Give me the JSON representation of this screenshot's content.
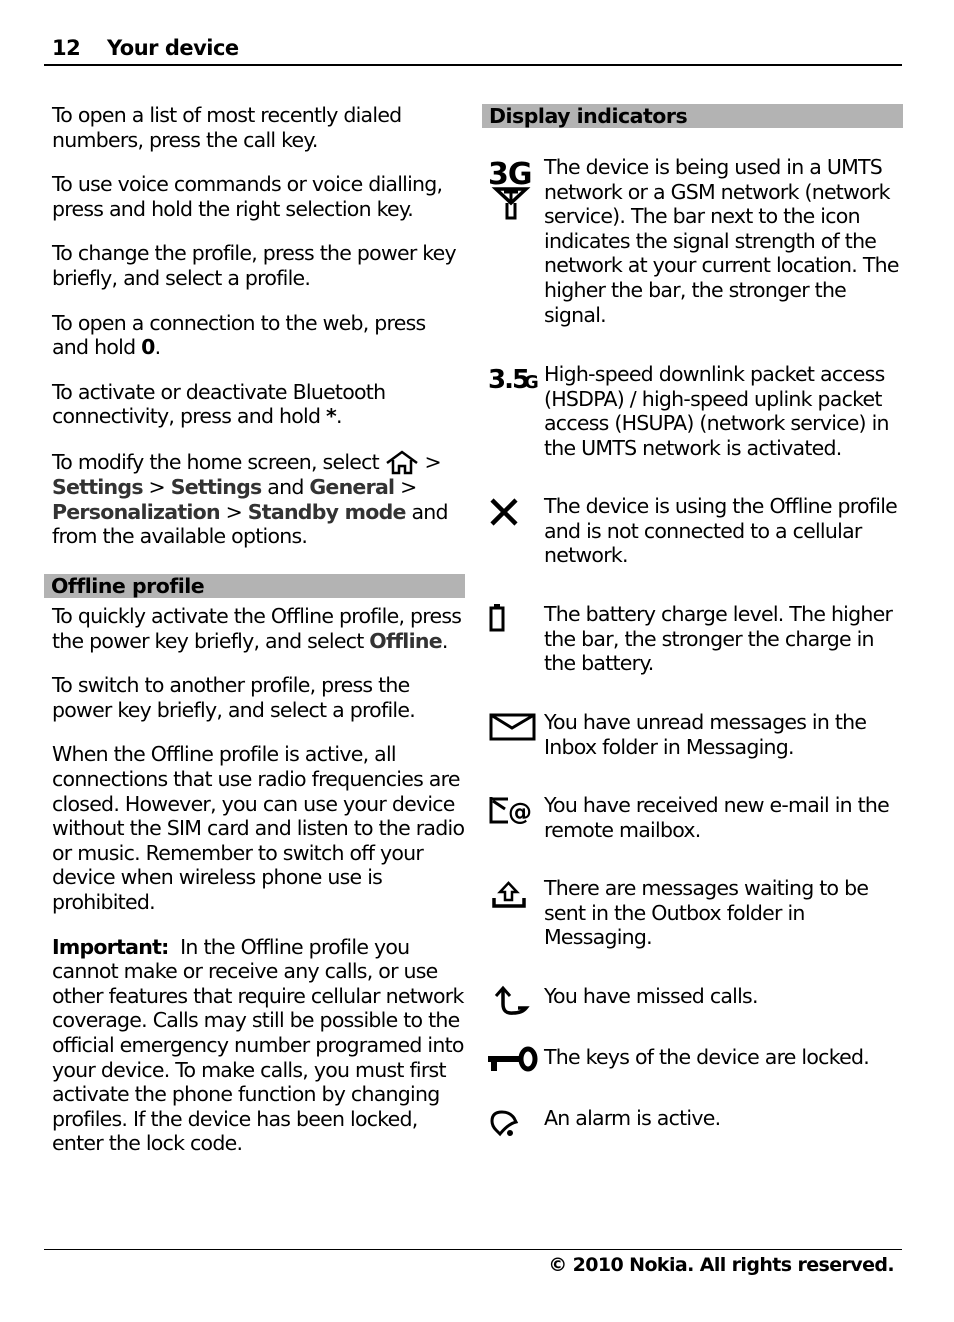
{
  "header": {
    "page_number": "12",
    "title": "Your device"
  },
  "left": {
    "p1": "To open a list of most recently dialed numbers, press the call key.",
    "p2": "To use voice commands or voice dialling, press and hold the right selection key.",
    "p3": "To change the profile, press the power key briefly, and select a profile.",
    "p4_pre": "To open a connection to the web, press and hold ",
    "p4_key": "0",
    "p4_post": ".",
    "p5_pre": "To activate or deactivate Bluetooth connectivity, press and hold ",
    "p5_key": "*",
    "p5_post": ".",
    "p6": {
      "pre": "To modify the home screen, select ",
      "icon": "home-icon",
      "sep1": " > ",
      "settings1": "Settings",
      "sep2": " > ",
      "settings2": "Settings",
      "and": " and ",
      "general": "General",
      "sep3": " > ",
      "personalization": "Personalization",
      "sep4": " > ",
      "standby": "Standby mode",
      "post": " and from the available options."
    },
    "offline_heading": "Offline profile",
    "op1_pre": "To quickly activate the Offline profile, press the power key briefly, and select ",
    "op1_ui": "Offline",
    "op1_post": ".",
    "op2": "To switch to another profile, press the power key briefly, and select a profile.",
    "op3": "When the Offline profile is active, all connections that use radio frequencies are closed. However, you can use your device without the SIM card and listen to the radio or music. Remember to switch off your device when wireless phone use is prohibited.",
    "important_label": "Important:",
    "important_text": "In the Offline profile you cannot make or receive any calls, or use other features that require cellular network coverage. Calls may still be possible to the official emergency number programed into your device. To make calls, you must first activate the phone function by changing profiles. If the device has been locked, enter the lock code."
  },
  "right": {
    "heading": "Display indicators",
    "indicators": [
      {
        "icon": "3g-signal-icon",
        "icon_text": "3G",
        "text": "The device is being used in a UMTS network or a GSM network (network service). The bar next to the icon indicates the signal strength of the network at your current location. The higher the bar, the stronger the signal."
      },
      {
        "icon": "3-5g-icon",
        "icon_text": "3.5G",
        "text": "High-speed downlink packet access (HSDPA) / high-speed uplink packet access (HSUPA) (network service) in the UMTS network is activated."
      },
      {
        "icon": "offline-x-icon",
        "text": "The device is using the Offline profile and is not connected to a cellular network."
      },
      {
        "icon": "battery-icon",
        "text": "The battery charge level. The higher the bar, the stronger the charge in the battery."
      },
      {
        "icon": "envelope-icon",
        "text": "You have unread messages in the Inbox folder in Messaging."
      },
      {
        "icon": "email-at-icon",
        "text": "You have received new e-mail in the remote mailbox."
      },
      {
        "icon": "outbox-icon",
        "text": "There are messages waiting to be sent in the Outbox folder in Messaging."
      },
      {
        "icon": "missed-call-icon",
        "text": "You have missed calls."
      },
      {
        "icon": "key-lock-icon",
        "text": "The keys of the device are locked."
      },
      {
        "icon": "alarm-bell-icon",
        "text": "An alarm is active."
      }
    ]
  },
  "footer": {
    "copyright": "© 2010 Nokia. All rights reserved."
  }
}
